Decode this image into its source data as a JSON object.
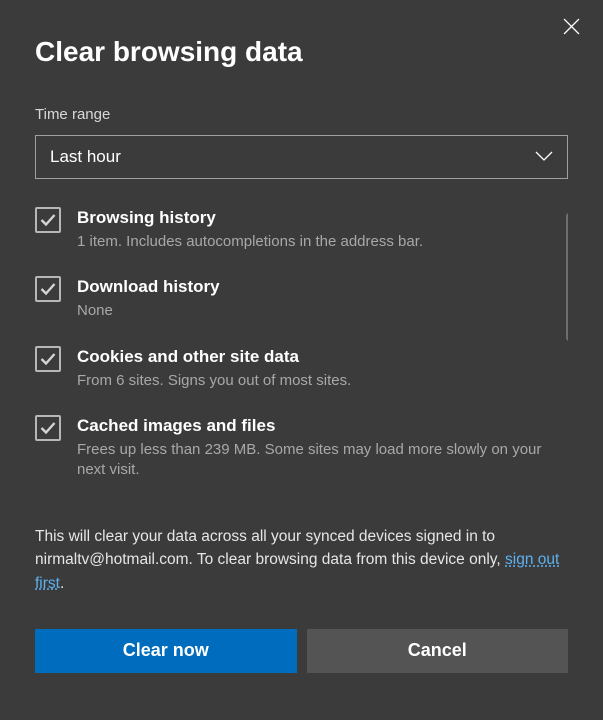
{
  "dialog": {
    "title": "Clear browsing data",
    "time_range_label": "Time range",
    "time_range_value": "Last hour",
    "options": [
      {
        "title": "Browsing history",
        "desc": "1 item. Includes autocompletions in the address bar."
      },
      {
        "title": "Download history",
        "desc": "None"
      },
      {
        "title": "Cookies and other site data",
        "desc": "From 6 sites. Signs you out of most sites."
      },
      {
        "title": "Cached images and files",
        "desc": "Frees up less than 239 MB. Some sites may load more slowly on your next visit."
      }
    ],
    "footer_text_1": "This will clear your data across all your synced devices signed in to nirmaltv@hotmail.com. To clear browsing data from this device only, ",
    "footer_link": "sign out first",
    "footer_text_2": ".",
    "buttons": {
      "clear": "Clear now",
      "cancel": "Cancel"
    }
  }
}
